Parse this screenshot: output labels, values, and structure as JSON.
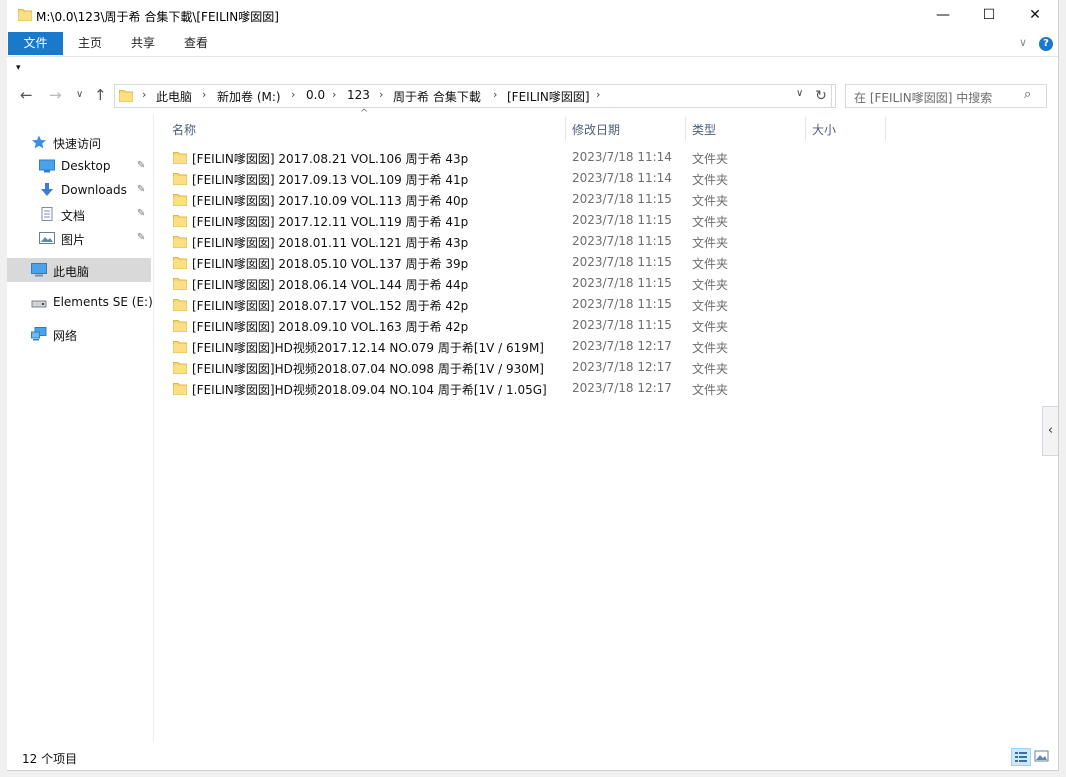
{
  "window": {
    "title": "M:\\0.0\\123\\周于希 合集下載\\[FEILIN嗲囡囡]",
    "minimize_glyph": "—",
    "maximize_glyph": "☐",
    "close_glyph": "✕"
  },
  "ribbon": {
    "tabs": [
      {
        "label": "文件"
      },
      {
        "label": "主页"
      },
      {
        "label": "共享"
      },
      {
        "label": "查看"
      }
    ],
    "expand_glyph": "∨",
    "help_label": "?"
  },
  "qat": {
    "glyph": "▾"
  },
  "nav": {
    "back": "←",
    "forward": "→",
    "recent": "∨",
    "up": "↑",
    "breadcrumb": [
      "此电脑",
      "新加卷 (M:)",
      "0.0",
      "123",
      "周于希 合集下載",
      "[FEILIN嗲囡囡]"
    ],
    "separator": "›",
    "address_dropdown": "∨",
    "refresh": "↻",
    "search_placeholder": "在 [FEILIN嗲囡囡] 中搜索",
    "search_glyph": "⌕"
  },
  "sidebar": {
    "items": [
      {
        "label": "快速访问",
        "icon": "star-icon"
      },
      {
        "label": "Desktop",
        "icon": "desktop-icon",
        "pinned": true
      },
      {
        "label": "Downloads",
        "icon": "download-icon",
        "pinned": true
      },
      {
        "label": "文档",
        "icon": "document-icon",
        "pinned": true
      },
      {
        "label": "图片",
        "icon": "picture-icon",
        "pinned": true
      },
      {
        "label": "此电脑",
        "icon": "computer-icon",
        "selected": true
      },
      {
        "label": "Elements SE (E:)",
        "icon": "drive-icon"
      },
      {
        "label": "网络",
        "icon": "network-icon"
      }
    ],
    "pin_glyph": "📌"
  },
  "columns": {
    "name": "名称",
    "date": "修改日期",
    "type": "类型",
    "size": "大小",
    "sort_glyph": "^"
  },
  "files": [
    {
      "name": "[FEILIN嗲囡囡] 2017.08.21 VOL.106 周于希 43p",
      "date": "2023/7/18 11:14",
      "type": "文件夹"
    },
    {
      "name": "[FEILIN嗲囡囡] 2017.09.13 VOL.109 周于希 41p",
      "date": "2023/7/18 11:14",
      "type": "文件夹"
    },
    {
      "name": "[FEILIN嗲囡囡] 2017.10.09 VOL.113 周于希 40p",
      "date": "2023/7/18 11:15",
      "type": "文件夹"
    },
    {
      "name": "[FEILIN嗲囡囡] 2017.12.11 VOL.119 周于希 41p",
      "date": "2023/7/18 11:15",
      "type": "文件夹"
    },
    {
      "name": "[FEILIN嗲囡囡] 2018.01.11 VOL.121 周于希 43p",
      "date": "2023/7/18 11:15",
      "type": "文件夹"
    },
    {
      "name": "[FEILIN嗲囡囡] 2018.05.10 VOL.137 周于希 39p",
      "date": "2023/7/18 11:15",
      "type": "文件夹"
    },
    {
      "name": "[FEILIN嗲囡囡] 2018.06.14 VOL.144 周于希 44p",
      "date": "2023/7/18 11:15",
      "type": "文件夹"
    },
    {
      "name": "[FEILIN嗲囡囡] 2018.07.17 VOL.152 周于希 42p",
      "date": "2023/7/18 11:15",
      "type": "文件夹"
    },
    {
      "name": "[FEILIN嗲囡囡] 2018.09.10 VOL.163 周于希 42p",
      "date": "2023/7/18 11:15",
      "type": "文件夹"
    },
    {
      "name": "[FEILIN嗲囡囡]HD视频2017.12.14 NO.079 周于希[1V / 619M]",
      "date": "2023/7/18 12:17",
      "type": "文件夹"
    },
    {
      "name": "[FEILIN嗲囡囡]HD视频2018.07.04 NO.098 周于希[1V / 930M]",
      "date": "2023/7/18 12:17",
      "type": "文件夹"
    },
    {
      "name": "[FEILIN嗲囡囡]HD视频2018.09.04 NO.104 周于希[1V / 1.05G]",
      "date": "2023/7/18 12:17",
      "type": "文件夹"
    }
  ],
  "side_tab_glyph": "‹",
  "status": {
    "item_count": "12 个项目"
  },
  "colors": {
    "accent": "#1979ca",
    "folder": "#f8d775",
    "selected_bg": "#d9d9d9"
  }
}
